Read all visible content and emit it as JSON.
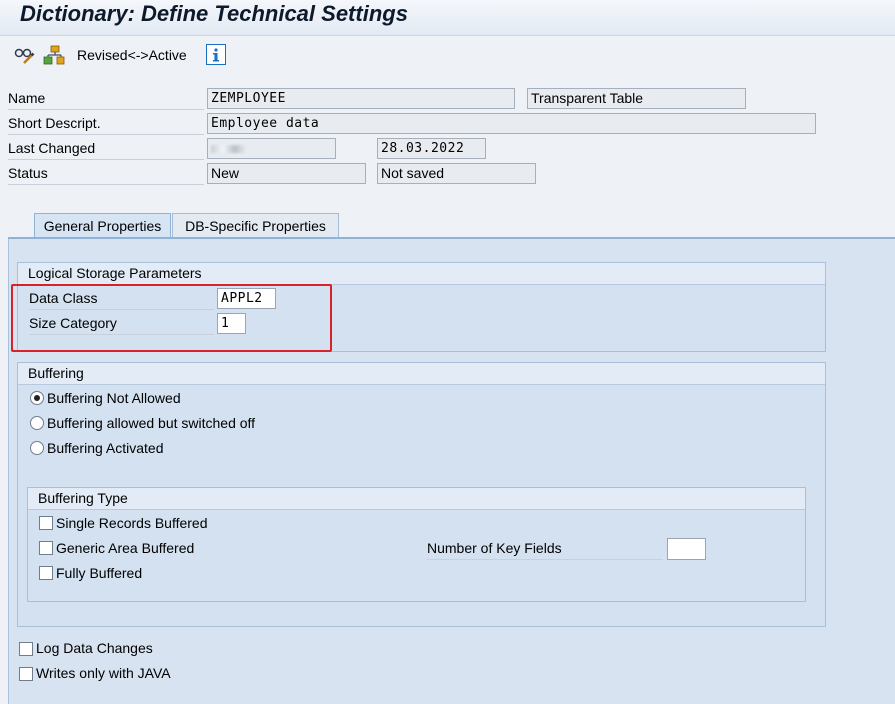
{
  "window": {
    "title": "Dictionary: Define Technical Settings"
  },
  "toolbar": {
    "display_change_icon": "glasses-pencil-icon",
    "activate_icon": "hierarchy-icon",
    "revised_active_label": "Revised<->Active",
    "info_icon": "info-icon"
  },
  "header": {
    "name_label": "Name",
    "name_value": "ZEMPLOYEE",
    "table_type": "Transparent Table",
    "short_desc_label": "Short Descript.",
    "short_desc_value": "Employee data",
    "last_changed_label": "Last Changed",
    "last_changed_user": "",
    "last_changed_date": "28.03.2022",
    "status_label": "Status",
    "status_value": "New",
    "save_status": "Not saved"
  },
  "tabs": [
    {
      "label": "General Properties",
      "active": true
    },
    {
      "label": "DB-Specific Properties",
      "active": false
    }
  ],
  "logical_storage": {
    "title": "Logical Storage Parameters",
    "data_class_label": "Data Class",
    "data_class_value": "APPL2",
    "size_category_label": "Size Category",
    "size_category_value": "1"
  },
  "buffering": {
    "title": "Buffering",
    "options": [
      {
        "label": "Buffering Not Allowed",
        "selected": true
      },
      {
        "label": "Buffering allowed but switched off",
        "selected": false
      },
      {
        "label": "Buffering Activated",
        "selected": false
      }
    ]
  },
  "buffering_type": {
    "title": "Buffering Type",
    "options": [
      {
        "label": "Single Records Buffered",
        "checked": false
      },
      {
        "label": "Generic Area Buffered",
        "checked": false
      },
      {
        "label": "Fully Buffered",
        "checked": false
      }
    ],
    "key_fields_label": "Number of Key Fields",
    "key_fields_value": ""
  },
  "extra_options": [
    {
      "label": "Log Data Changes",
      "checked": false
    },
    {
      "label": "Writes only with JAVA",
      "checked": false
    }
  ],
  "colors": {
    "panel": "#d7e3f1",
    "group_head": "#e2ebf6",
    "highlight": "#d6232a",
    "info_blue": "#1a6fc4"
  }
}
